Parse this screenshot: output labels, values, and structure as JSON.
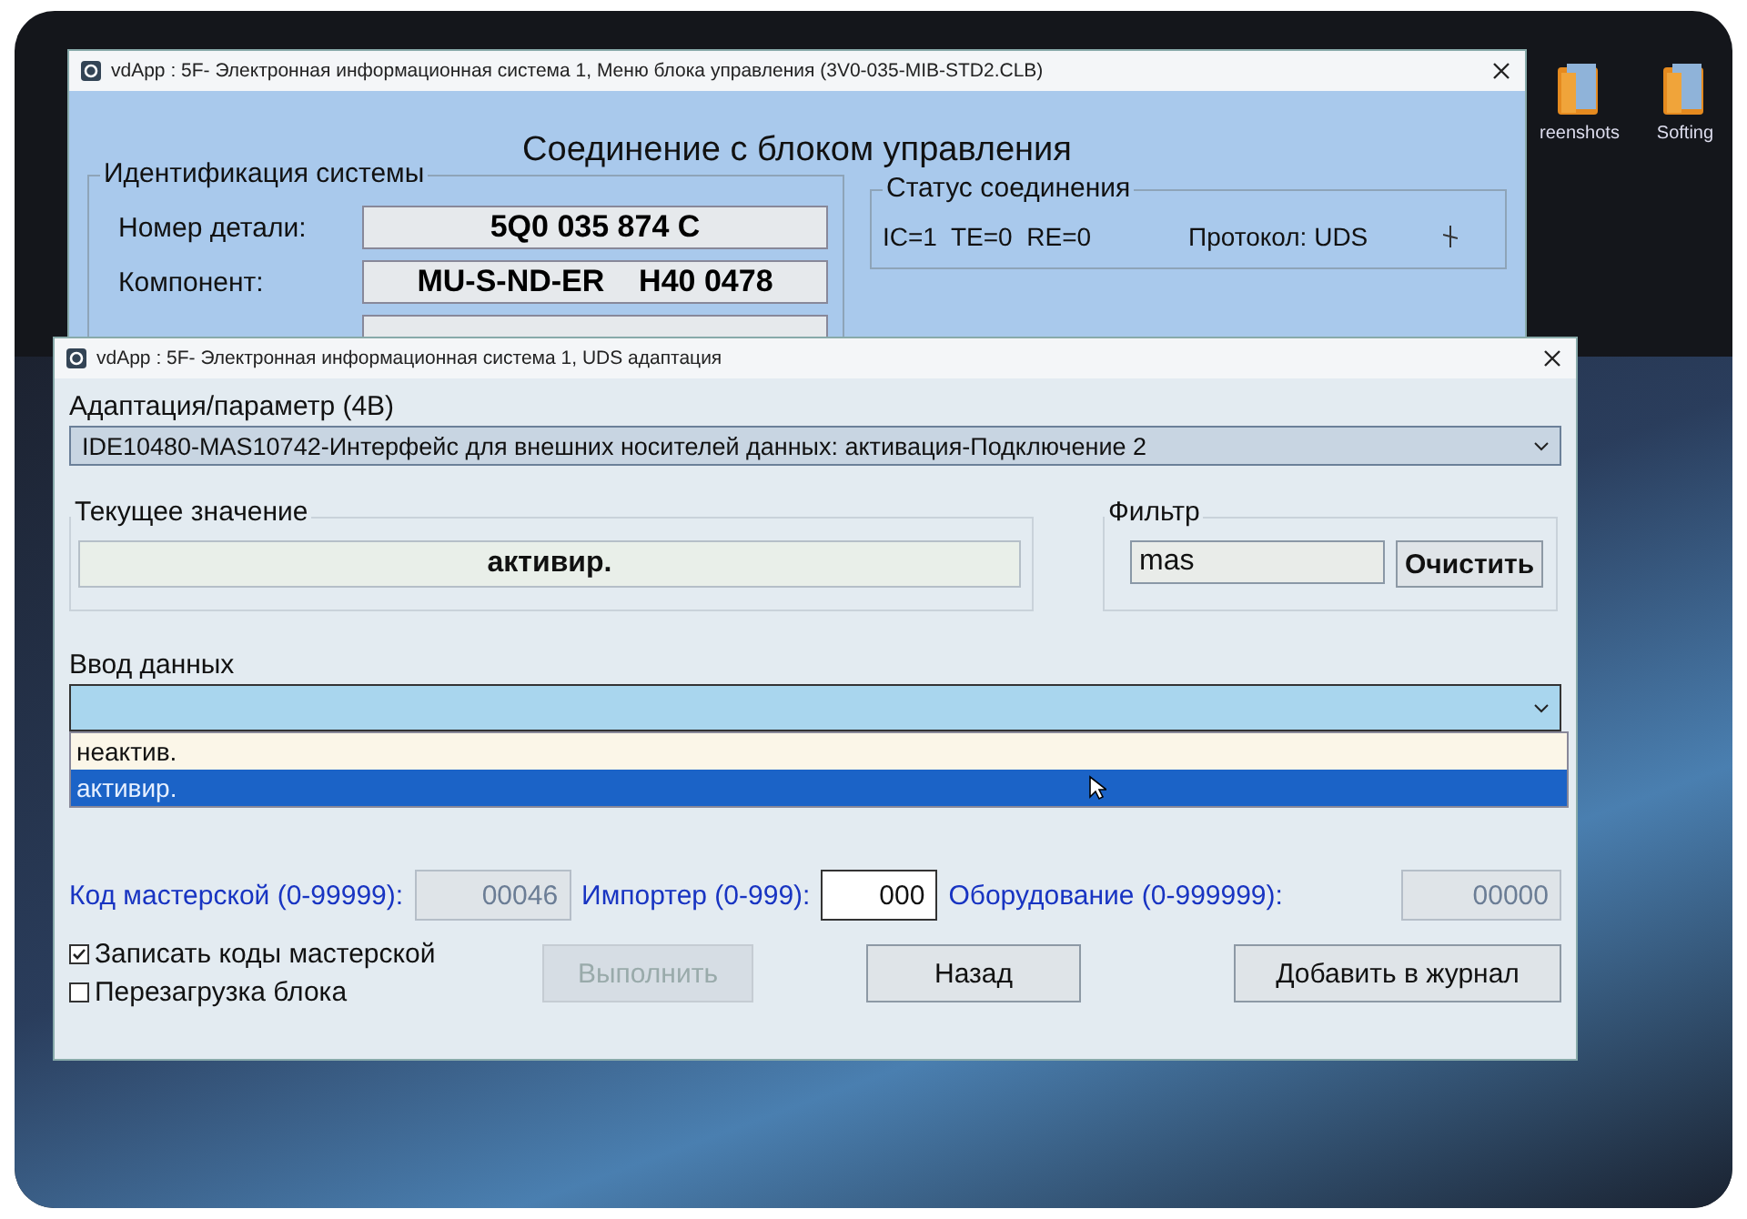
{
  "desktop": {
    "icons": [
      {
        "label": "reenshots"
      },
      {
        "label": "Softing"
      }
    ]
  },
  "back_window": {
    "title": "vdApp : 5F- Электронная информационная система 1,  Меню блока управления (3V0-035-MIB-STD2.CLB)",
    "heading": "Соединение с блоком управления",
    "identification": {
      "title": "Идентификация системы",
      "fields": [
        {
          "label": "Номер детали:",
          "value": "5Q0 035 874 C"
        },
        {
          "label": "Компонент:",
          "value": "MU-S-ND-ER    H40 0478"
        }
      ]
    },
    "connection_status": {
      "title": "Статус соединения",
      "counters": "IC=1  TE=0  RE=0",
      "protocol": "Протокол: UDS"
    }
  },
  "dialog": {
    "title": "vdApp : 5F- Электронная информационная система 1,  UDS адаптация",
    "adaptation": {
      "label": "Адаптация/параметр (4B)",
      "value": "IDE10480-MAS10742-Интерфейс для внешних носителей данных: активация-Подключение 2"
    },
    "current_value": {
      "label": "Текущее значение",
      "value": "активир."
    },
    "filter": {
      "label": "Фильтр",
      "value": "mas",
      "clear_button": "Очистить"
    },
    "data_input": {
      "label": "Ввод данных",
      "options": [
        {
          "label": "неактив.",
          "selected": false
        },
        {
          "label": "активир.",
          "selected": true
        }
      ]
    },
    "codes": [
      {
        "label": "Код мастерской (0-99999):",
        "value": "00046",
        "disabled": true
      },
      {
        "label": "Импортер (0-999):",
        "value": "000",
        "disabled": false
      },
      {
        "label": "Оборудование (0-999999):",
        "value": "00000",
        "disabled": true
      }
    ],
    "checkboxes": [
      {
        "label": "Записать коды мастерской",
        "checked": true
      },
      {
        "label": "Перезагрузка блока",
        "checked": false
      }
    ],
    "buttons": [
      {
        "label": "Выполнить",
        "disabled": true
      },
      {
        "label": "Назад",
        "disabled": false
      },
      {
        "label": "Добавить в журнал",
        "disabled": false
      }
    ]
  }
}
